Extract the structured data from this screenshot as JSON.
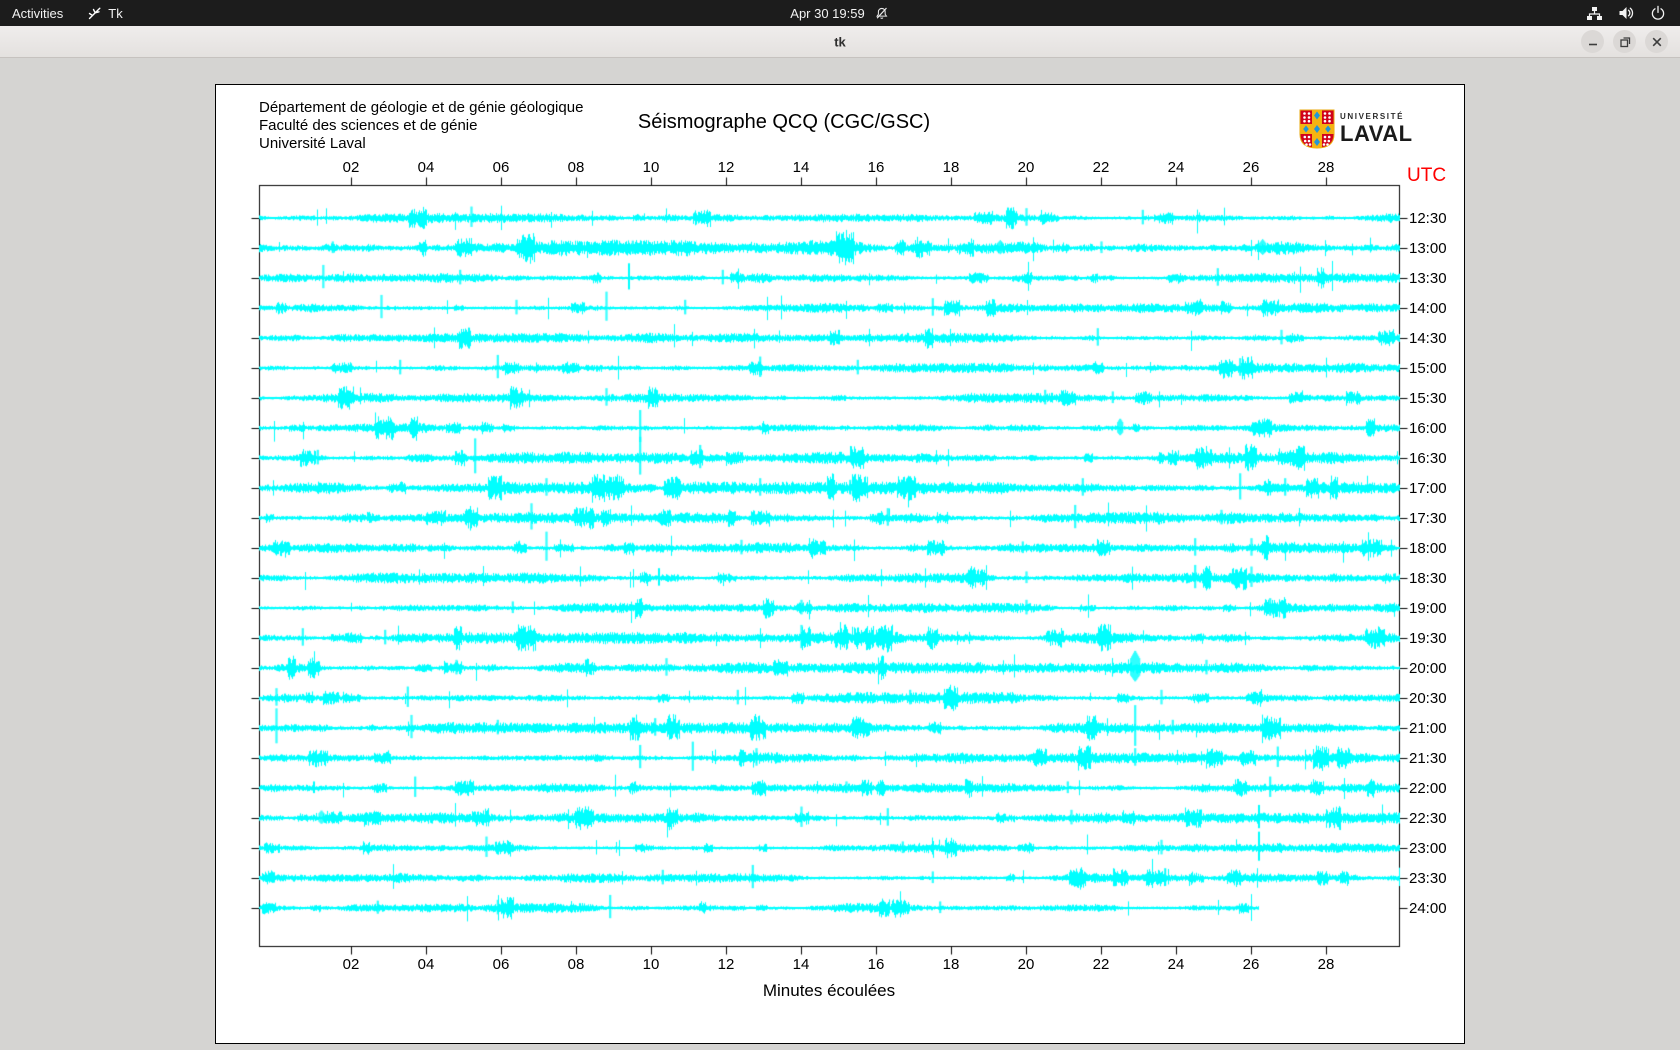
{
  "top_bar": {
    "activities_label": "Activities",
    "app_indicator_label": "Tk",
    "clock": "Apr 30 19:59",
    "icons": [
      "tk-icon",
      "notifications-off-icon",
      "network-icon",
      "volume-icon",
      "power-icon"
    ]
  },
  "window": {
    "title": "tk",
    "controls": [
      "minimize",
      "restore",
      "close"
    ]
  },
  "seismograph": {
    "header_lines": [
      "Département de géologie et de génie géologique",
      "Faculté des sciences et de génie",
      "Université Laval"
    ],
    "title": "Séismographe QCQ (CGC/GSC)",
    "logo": {
      "line1": "UNIVERSITÉ",
      "line2": "LAVAL"
    },
    "utc_label": "UTC",
    "xlabel": "Minutes écoulées",
    "colors": {
      "trace": "#00ffff",
      "utc_label": "#ff0000",
      "frame": "#000000"
    }
  },
  "chart_data": {
    "type": "line",
    "subtype": "helicorder-seismogram",
    "title": "Séismographe QCQ (CGC/GSC)",
    "xlabel": "Minutes écoulées",
    "right_axis_label": "UTC",
    "x_ticks": [
      "02",
      "04",
      "06",
      "08",
      "10",
      "12",
      "14",
      "16",
      "18",
      "20",
      "22",
      "24",
      "26",
      "28"
    ],
    "x_range_minutes": [
      0,
      30
    ],
    "minutes_per_row": 30,
    "trace_color": "#00ffff",
    "traces": [
      {
        "utc": "12:30",
        "activity": 1.0,
        "spikes": [
          [
            5.2,
            14
          ],
          [
            20.0,
            12
          ],
          [
            23.1,
            10
          ]
        ]
      },
      {
        "utc": "13:00",
        "activity": 1.65,
        "spikes": [
          [
            1.5,
            8
          ],
          [
            9.5,
            9
          ],
          [
            14.8,
            8,
            6
          ],
          [
            19.3,
            8,
            6
          ],
          [
            22.0,
            8
          ],
          [
            26.3,
            9,
            6
          ]
        ]
      },
      {
        "utc": "13:30",
        "activity": 1.0,
        "spikes": [
          [
            1.25,
            16
          ],
          [
            4.9,
            10
          ],
          [
            9.4,
            18
          ],
          [
            11.9,
            10
          ],
          [
            25.1,
            12
          ]
        ]
      },
      {
        "utc": "14:00",
        "activity": 1.0,
        "spikes": [
          [
            2.8,
            16
          ],
          [
            6.4,
            10
          ],
          [
            8.8,
            20
          ],
          [
            10.9,
            10
          ],
          [
            17.5,
            12
          ]
        ]
      },
      {
        "utc": "14:30",
        "activity": 1.0,
        "spikes": [
          [
            15.0,
            10
          ],
          [
            21.9,
            12
          ],
          [
            26.8,
            10
          ]
        ]
      },
      {
        "utc": "15:00",
        "activity": 1.0,
        "spikes": [
          [
            3.3,
            10
          ],
          [
            5.9,
            16
          ],
          [
            12.9,
            14
          ],
          [
            15.5,
            10
          ],
          [
            25.7,
            12
          ]
        ]
      },
      {
        "utc": "15:30",
        "activity": 1.0,
        "spikes": [
          [
            8.8,
            12
          ],
          [
            20.5,
            10
          ],
          [
            22.3,
            8
          ]
        ]
      },
      {
        "utc": "16:00",
        "activity": 1.1,
        "spikes": [
          [
            9.7,
            22
          ],
          [
            22.5,
            10,
            5
          ],
          [
            26.5,
            8
          ]
        ]
      },
      {
        "utc": "16:30",
        "activity": 1.2,
        "spikes": [
          [
            1.1,
            10
          ],
          [
            5.3,
            24
          ],
          [
            9.7,
            26
          ],
          [
            11.3,
            16
          ]
        ]
      },
      {
        "utc": "17:00",
        "activity": 1.25,
        "spikes": [
          [
            7.2,
            12
          ],
          [
            12.9,
            12
          ],
          [
            15.3,
            10
          ],
          [
            21.5,
            12
          ],
          [
            25.7,
            18
          ],
          [
            26.9,
            12
          ]
        ]
      },
      {
        "utc": "17:30",
        "activity": 1.25,
        "spikes": [
          [
            6.8,
            18
          ],
          [
            8.1,
            12
          ],
          [
            16.3,
            12
          ],
          [
            21.3,
            16
          ],
          [
            25.2,
            10
          ]
        ]
      },
      {
        "utc": "18:00",
        "activity": 1.2,
        "spikes": [
          [
            7.2,
            20
          ],
          [
            12.4,
            10
          ],
          [
            19.9,
            8
          ],
          [
            24.5,
            12
          ],
          [
            26.0,
            12
          ]
        ]
      },
      {
        "utc": "18:30",
        "activity": 1.1,
        "spikes": [
          [
            10.2,
            12
          ],
          [
            20.0,
            8
          ],
          [
            24.5,
            16
          ],
          [
            26.0,
            14
          ]
        ]
      },
      {
        "utc": "19:00",
        "activity": 1.0,
        "spikes": [
          [
            6.3,
            8
          ],
          [
            14.0,
            10
          ],
          [
            20.0,
            10
          ],
          [
            26.5,
            12
          ]
        ]
      },
      {
        "utc": "19:30",
        "activity": 1.2,
        "spikes": [
          [
            0.7,
            12
          ],
          [
            2.9,
            10
          ],
          [
            14.0,
            16
          ],
          [
            15.2,
            10
          ],
          [
            22.1,
            12
          ]
        ]
      },
      {
        "utc": "20:00",
        "activity": 1.2,
        "spikes": [
          [
            4.8,
            10
          ],
          [
            10.4,
            12
          ],
          [
            22.9,
            18,
            9
          ],
          [
            24.8,
            10
          ]
        ]
      },
      {
        "utc": "20:30",
        "activity": 1.2,
        "spikes": [
          [
            0.0,
            12
          ],
          [
            3.5,
            14
          ],
          [
            12.3,
            10
          ],
          [
            16.9,
            10
          ],
          [
            23.6,
            10
          ]
        ]
      },
      {
        "utc": "21:00",
        "activity": 1.2,
        "spikes": [
          [
            0.0,
            24
          ],
          [
            3.6,
            16
          ],
          [
            5.9,
            10
          ],
          [
            10.1,
            12
          ],
          [
            22.9,
            28
          ],
          [
            23.9,
            10
          ]
        ]
      },
      {
        "utc": "21:30",
        "activity": 1.1,
        "spikes": [
          [
            9.7,
            16
          ],
          [
            11.1,
            20
          ],
          [
            12.8,
            12
          ],
          [
            22.9,
            12
          ],
          [
            26.7,
            14
          ]
        ]
      },
      {
        "utc": "22:00",
        "activity": 1.0,
        "spikes": [
          [
            1.0,
            8
          ],
          [
            3.7,
            14
          ],
          [
            15.2,
            8
          ],
          [
            21.1,
            8
          ],
          [
            26.5,
            14
          ]
        ]
      },
      {
        "utc": "22:30",
        "activity": 1.1,
        "spikes": [
          [
            1.2,
            8,
            5
          ],
          [
            14.0,
            14
          ],
          [
            16.3,
            12
          ],
          [
            21.2,
            10
          ],
          [
            26.2,
            16
          ]
        ]
      },
      {
        "utc": "23:00",
        "activity": 1.0,
        "spikes": [
          [
            5.6,
            14
          ],
          [
            16.7,
            8
          ],
          [
            23.6,
            10
          ],
          [
            26.2,
            20
          ]
        ]
      },
      {
        "utc": "23:30",
        "activity": 1.0,
        "spikes": [
          [
            10.3,
            10
          ],
          [
            12.7,
            16
          ],
          [
            17.5,
            8
          ],
          [
            23.7,
            12
          ]
        ]
      },
      {
        "utc": "24:00",
        "activity": 1.0,
        "end_minute": 26.2,
        "spikes": [
          [
            2.7,
            9
          ],
          [
            5.9,
            10
          ],
          [
            8.9,
            16
          ],
          [
            17.7,
            8
          ]
        ]
      }
    ]
  }
}
